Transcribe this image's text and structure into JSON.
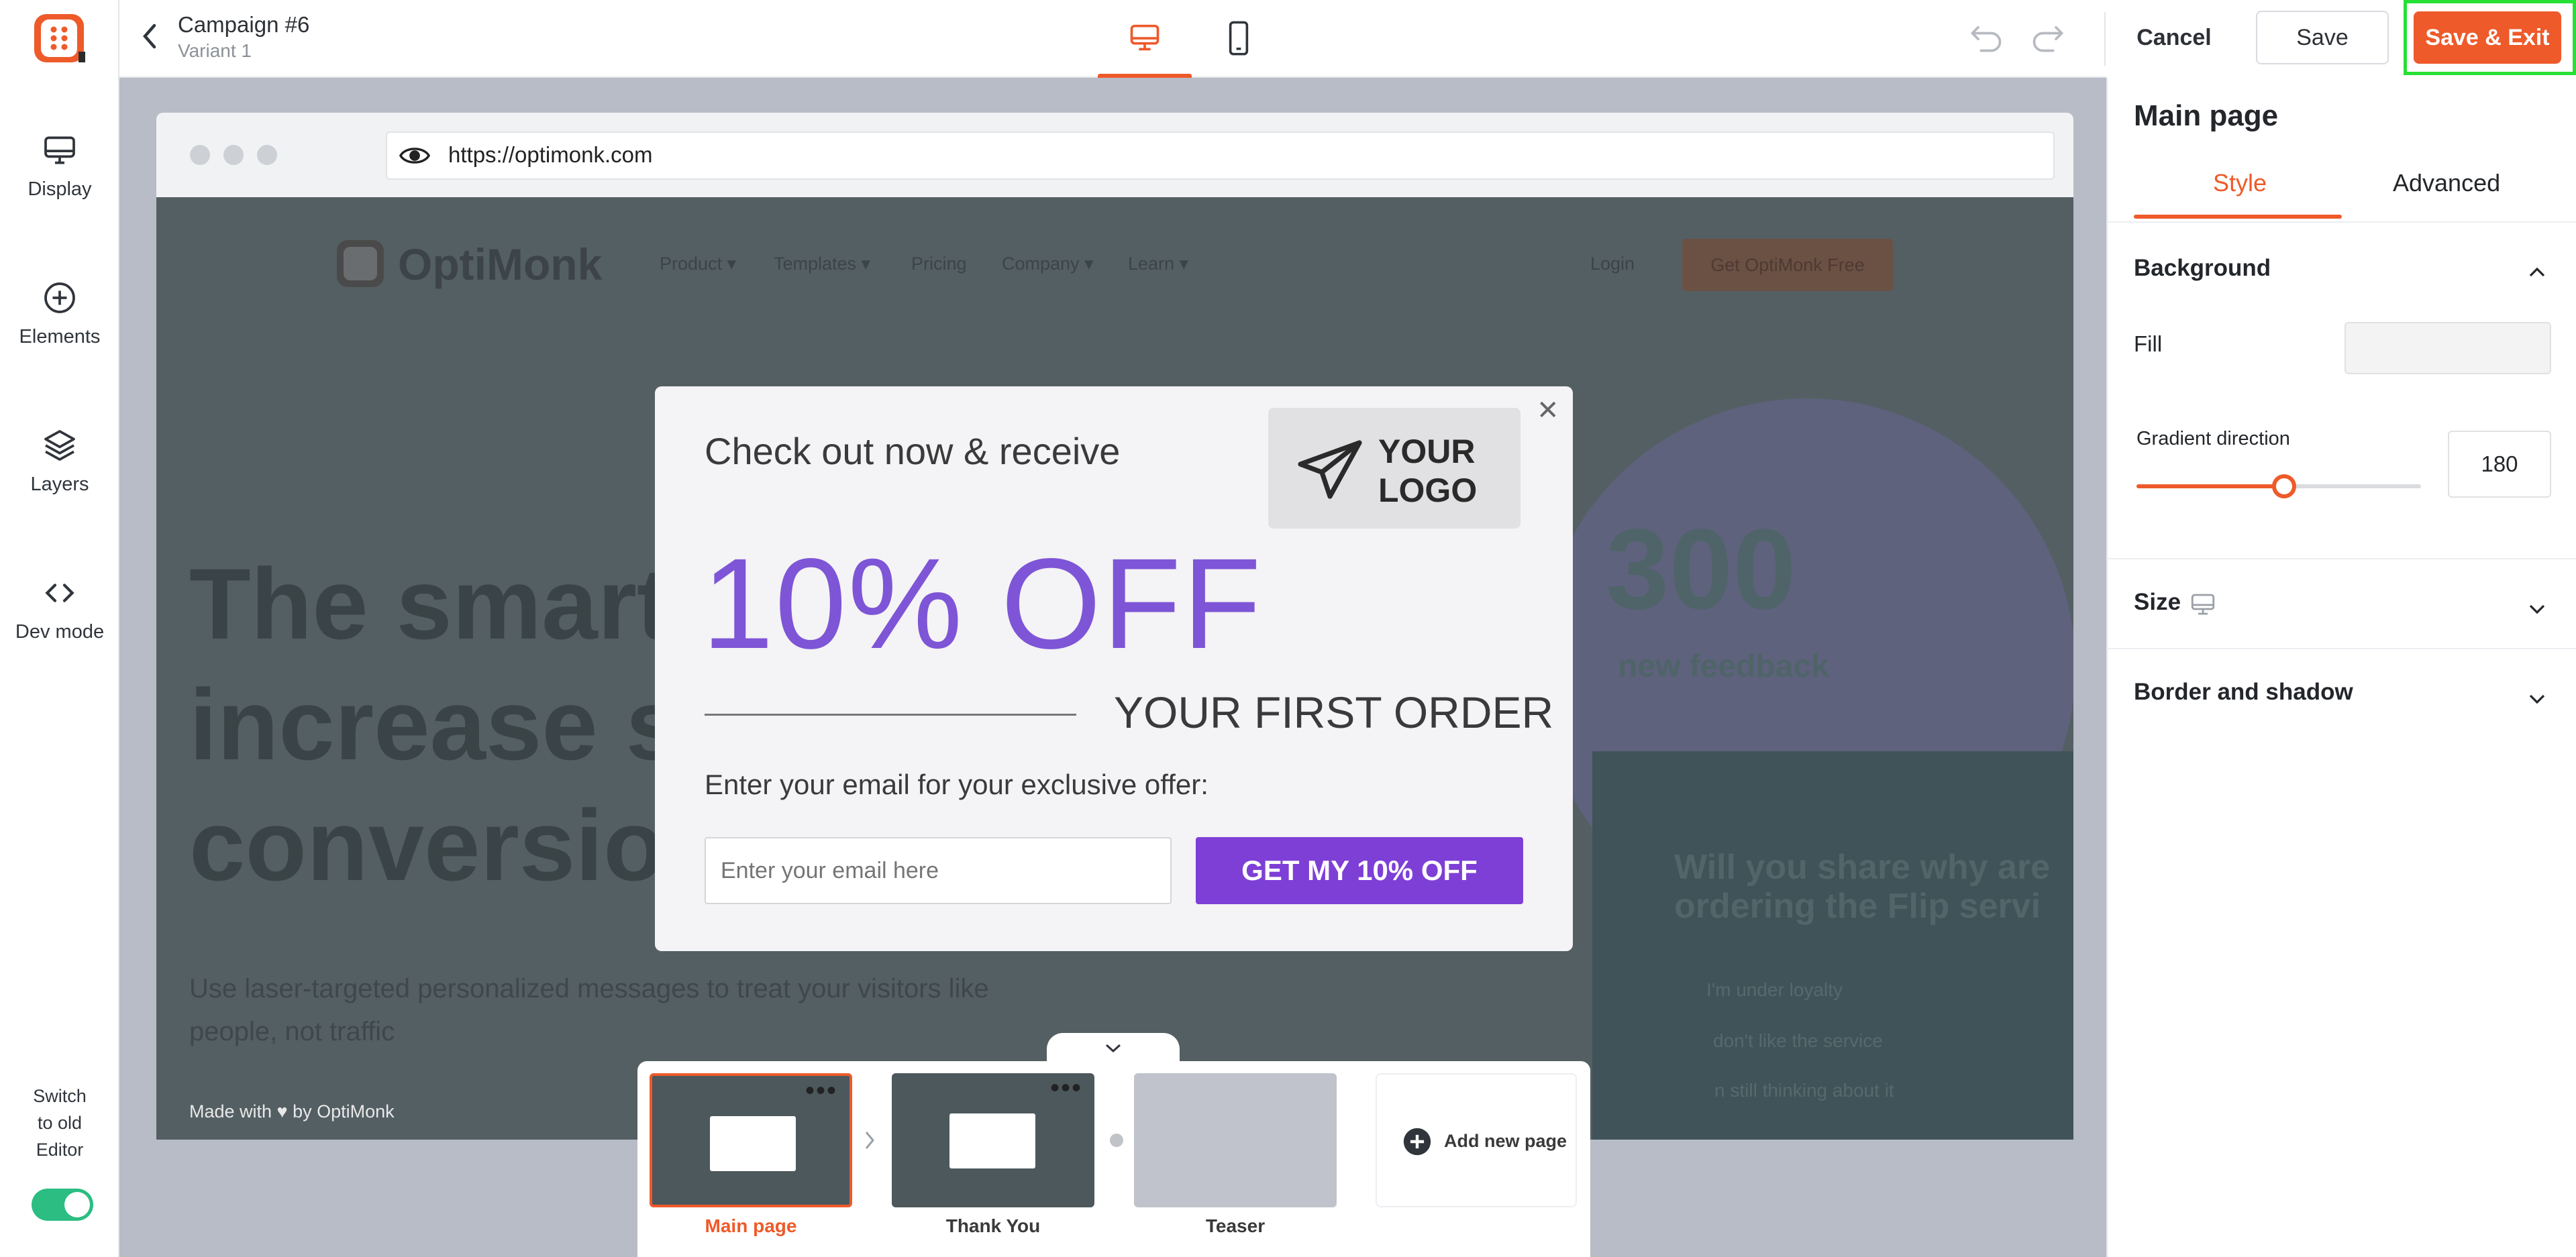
{
  "sidebar": {
    "items": [
      {
        "label": "Display",
        "icon": "monitor-icon"
      },
      {
        "label": "Elements",
        "icon": "plus-circle-icon"
      },
      {
        "label": "Layers",
        "icon": "layers-icon"
      },
      {
        "label": "Dev mode",
        "icon": "code-icon"
      }
    ],
    "switch_label_lines": [
      "Switch",
      "to old",
      "Editor"
    ],
    "switch_on": true
  },
  "header": {
    "campaign_title": "Campaign #6",
    "variant": "Variant 1",
    "device_tabs": [
      "desktop",
      "mobile"
    ],
    "active_device": "desktop",
    "cancel_label": "Cancel",
    "save_label": "Save",
    "save_exit_label": "Save & Exit"
  },
  "browser": {
    "url": "https://optimonk.com"
  },
  "site": {
    "brand": "OptiMonk",
    "nav": [
      "Product ▾",
      "Templates ▾",
      "Pricing",
      "Company ▾",
      "Learn ▾"
    ],
    "login": "Login",
    "cta": "Get OptiMonk Free",
    "hero_lines": [
      "The smarte",
      "increase sa",
      "conversion"
    ],
    "sub_lines": [
      "Use laser-targeted personalized messages to treat your visitors like",
      "people, not traffic"
    ],
    "stat_number": "300",
    "stat_label": "new feedback",
    "question_lines": [
      "Will you share why are",
      "ordering the Flip servi"
    ],
    "answers": [
      "I'm under loyalty",
      "don't like the service",
      "n still thinking about it"
    ],
    "made_with": "Made with ♥ by OptiMonk"
  },
  "popup": {
    "headline": "Check out now & receive",
    "logo_text_lines": [
      "YOUR",
      "LOGO"
    ],
    "discount": "10% OFF",
    "first_order": "YOUR FIRST ORDER",
    "email_prompt": "Enter your email for your exclusive offer:",
    "email_placeholder": "Enter your email here",
    "cta_label": "GET MY 10% OFF"
  },
  "pages": {
    "items": [
      {
        "label": "Main page",
        "active": true
      },
      {
        "label": "Thank You",
        "active": false
      },
      {
        "label": "Teaser",
        "active": false
      }
    ],
    "add_label": "Add new page"
  },
  "panel": {
    "title": "Main page",
    "tabs": [
      "Style",
      "Advanced"
    ],
    "active_tab": "Style",
    "background_title": "Background",
    "fill_label": "Fill",
    "gradient_label": "Gradient direction",
    "gradient_value": "180",
    "gradient_fraction": 0.5,
    "size_title": "Size",
    "border_title": "Border and shadow"
  },
  "colors": {
    "accent": "#ee5a2a",
    "purple": "#7e55d6",
    "highlight": "#26e035",
    "toggle": "#2bbd82"
  }
}
